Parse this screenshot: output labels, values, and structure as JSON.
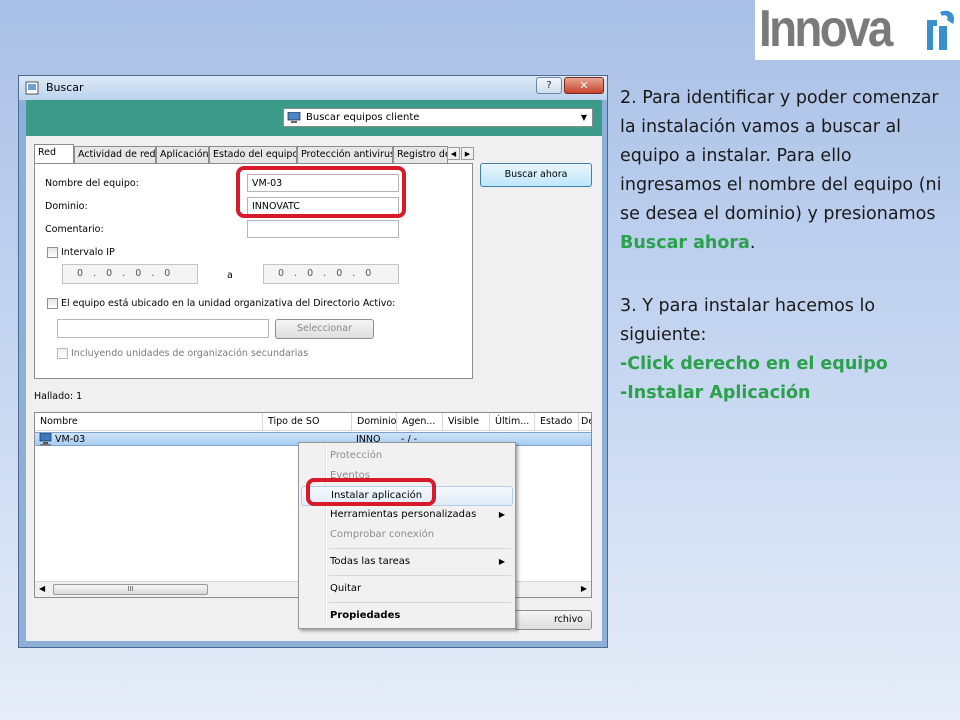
{
  "logo": {
    "text": "Innova"
  },
  "dialog": {
    "title": "Buscar",
    "help_label": "?",
    "close_label": "✕",
    "scope_select": "Buscar equipos cliente",
    "tabs": [
      "Red",
      "Actividad de red",
      "Aplicación",
      "Estado del equipo",
      "Protección antivirus",
      "Registro de"
    ],
    "tab_scroll_left": "◀",
    "tab_scroll_right": "▶",
    "fields": {
      "computer_name_label": "Nombre del equipo:",
      "computer_name_value": "VM-03",
      "domain_label": "Dominio:",
      "domain_value": "INNOVATC",
      "comment_label": "Comentario:",
      "comment_value": ""
    },
    "ip_range": {
      "label": "Intervalo IP",
      "from": "0 . 0 . 0 . 0",
      "sep": "a",
      "to": "0 . 0 . 0 . 0"
    },
    "ou": {
      "label": "El equipo está ubicado en la unidad organizativa del Directorio Activo:",
      "input_value": "",
      "select_button": "Seleccionar",
      "include_sub_label": "Incluyendo unidades de organización secundarias"
    },
    "search_now_button": "Buscar ahora",
    "found_label": "Hallado: 1",
    "columns": [
      "Nombre",
      "Tipo de SO",
      "Dominio",
      "Agen...",
      "Visible",
      "Últim...",
      "Estado",
      "De"
    ],
    "rows": [
      {
        "name": "VM-03",
        "os": "",
        "domain": "INNO",
        "agent": "- / -"
      }
    ],
    "hscroll_thumb": "III",
    "file_button_partial": "rchivo"
  },
  "context_menu": {
    "items": [
      {
        "label": "Protección",
        "disabled": true
      },
      {
        "label": "Eventos",
        "disabled": true
      },
      {
        "label": "Instalar aplicación",
        "highlight": true
      },
      {
        "label": "Herramientas personalizadas",
        "submenu": true
      },
      {
        "label": "Comprobar conexión",
        "disabled": true
      },
      {
        "label": "Todas las tareas",
        "submenu": true
      },
      {
        "label": "Quitar"
      },
      {
        "label": "Propiedades",
        "bold": true
      }
    ],
    "submenu_arrow": "▶"
  },
  "explanation": {
    "step2_text": "2. Para identificar y poder comenzar la instalación vamos a buscar al equipo a instalar. Para ello ingresamos el nombre del equipo (ni se desea el dominio) y presionamos ",
    "step2_highlight": "Buscar ahora",
    "step2_end": ".",
    "step3_text": "3. Y para instalar hacemos lo siguiente:",
    "step3_item1": "-Click derecho en el equipo",
    "step3_item2": "-Instalar Aplicación"
  },
  "colors": {
    "accent_green": "#2aa14a",
    "highlight_red": "#d7192a",
    "band_teal": "#3c9a88"
  }
}
